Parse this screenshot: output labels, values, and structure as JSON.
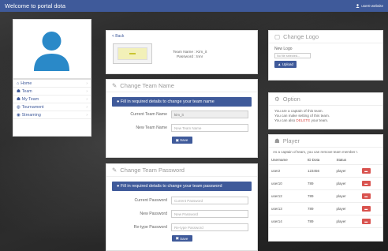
{
  "header": {
    "title": "Welcome to portal dota",
    "user": "user0 website"
  },
  "sidebar": {
    "items": [
      {
        "label": "Home"
      },
      {
        "label": "Team"
      },
      {
        "label": "My Team"
      },
      {
        "label": "Tournament"
      },
      {
        "label": "Streaming"
      }
    ]
  },
  "team_info": {
    "back": "< Back",
    "name_label": "Team Name",
    "name_value": ": Kim_it",
    "password_label": "Password",
    "password_value": ": tnnr"
  },
  "change_name": {
    "title": "Change Team Name",
    "alert": "Fill in required details to change your team name",
    "current_label": "Current Team Name",
    "current_value": "kim_it",
    "new_label": "New Team Name",
    "new_placeholder": "New Team Name",
    "button": "Save"
  },
  "change_password": {
    "title": "Change Team Password",
    "alert": "Fill in required details to change your team password",
    "current_label": "Current Password",
    "current_placeholder": "Current Password",
    "new_label": "New Password",
    "new_placeholder": "New Password",
    "retype_label": "Re-type Password",
    "retype_placeholder": "Re-type Password",
    "button": "Save"
  },
  "change_logo": {
    "title": "Change Logo",
    "new_logo_label": "New Logo",
    "file_button": "No file selected...",
    "upload": "Upload"
  },
  "option": {
    "title": "Option",
    "line1": "You are a captain of this team.",
    "line2": "You can make setting of this team.",
    "line3_prefix": "You can also",
    "line3_link": "DELETE",
    "line3_suffix": "your team."
  },
  "player": {
    "title": "Player",
    "note": "As a captain of team, you can remove team member !.",
    "columns": [
      "Username",
      "ID Dota",
      "Status"
    ],
    "rows": [
      {
        "username": "user2",
        "id": "123456",
        "status": "player"
      },
      {
        "username": "user10",
        "id": "789",
        "status": "player"
      },
      {
        "username": "user12",
        "id": "789",
        "status": "player"
      },
      {
        "username": "user13",
        "id": "789",
        "status": "player"
      },
      {
        "username": "user14",
        "id": "789",
        "status": "player"
      }
    ]
  },
  "colors": {
    "primary": "#3f5a9a",
    "danger": "#d9534f"
  }
}
